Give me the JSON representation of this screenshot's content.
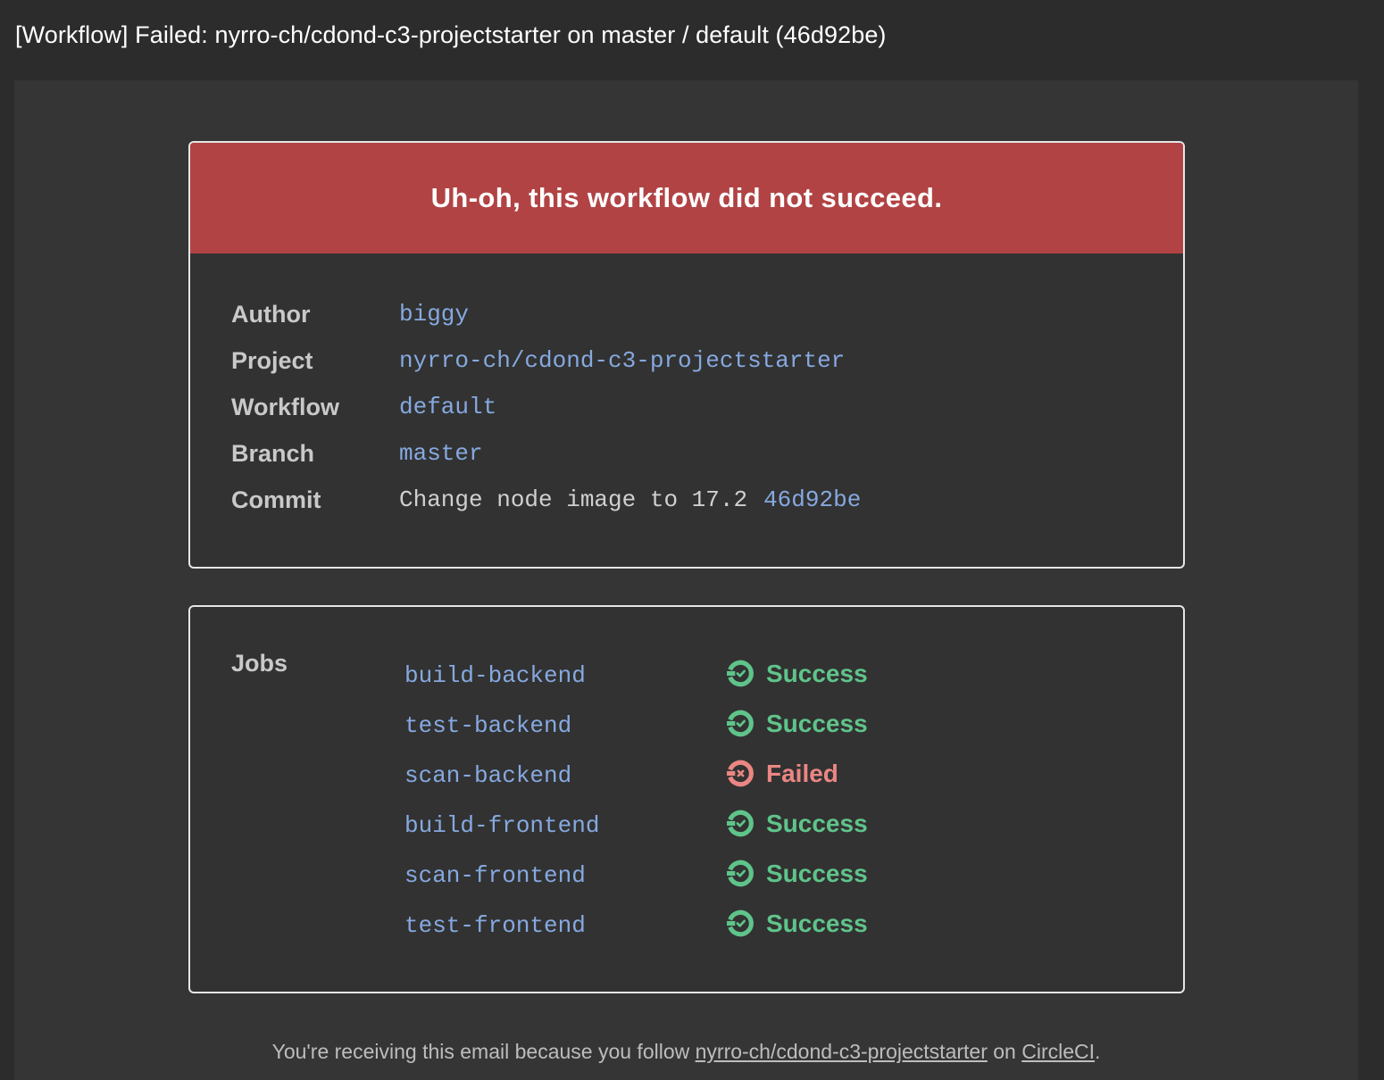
{
  "email": {
    "subject": "[Workflow] Failed: nyrro-ch/cdond-c3-projectstarter on master / default (46d92be)"
  },
  "banner": {
    "text": "Uh-oh, this workflow did not succeed.",
    "color": "#b14344"
  },
  "details": {
    "author_label": "Author",
    "author": "biggy",
    "project_label": "Project",
    "project": "nyrro-ch/cdond-c3-projectstarter",
    "workflow_label": "Workflow",
    "workflow": "default",
    "branch_label": "Branch",
    "branch": "master",
    "commit_label": "Commit",
    "commit_message": "Change node image to 17.2",
    "commit_sha": "46d92be"
  },
  "jobs": {
    "label": "Jobs",
    "items": [
      {
        "name": "build-backend",
        "status": "Success",
        "icon": "success-icon"
      },
      {
        "name": "test-backend",
        "status": "Success",
        "icon": "success-icon"
      },
      {
        "name": "scan-backend",
        "status": "Failed",
        "icon": "failed-icon"
      },
      {
        "name": "build-frontend",
        "status": "Success",
        "icon": "success-icon"
      },
      {
        "name": "scan-frontend",
        "status": "Success",
        "icon": "success-icon"
      },
      {
        "name": "test-frontend",
        "status": "Success",
        "icon": "success-icon"
      }
    ]
  },
  "footer": {
    "prefix": "You're receiving this email because you follow ",
    "project_link": "nyrro-ch/cdond-c3-projectstarter",
    "middle": " on ",
    "circleci_link": "CircleCI",
    "suffix": "."
  },
  "colors": {
    "link": "#86a9e0",
    "success": "#5fc48a",
    "failed": "#ea8683"
  }
}
